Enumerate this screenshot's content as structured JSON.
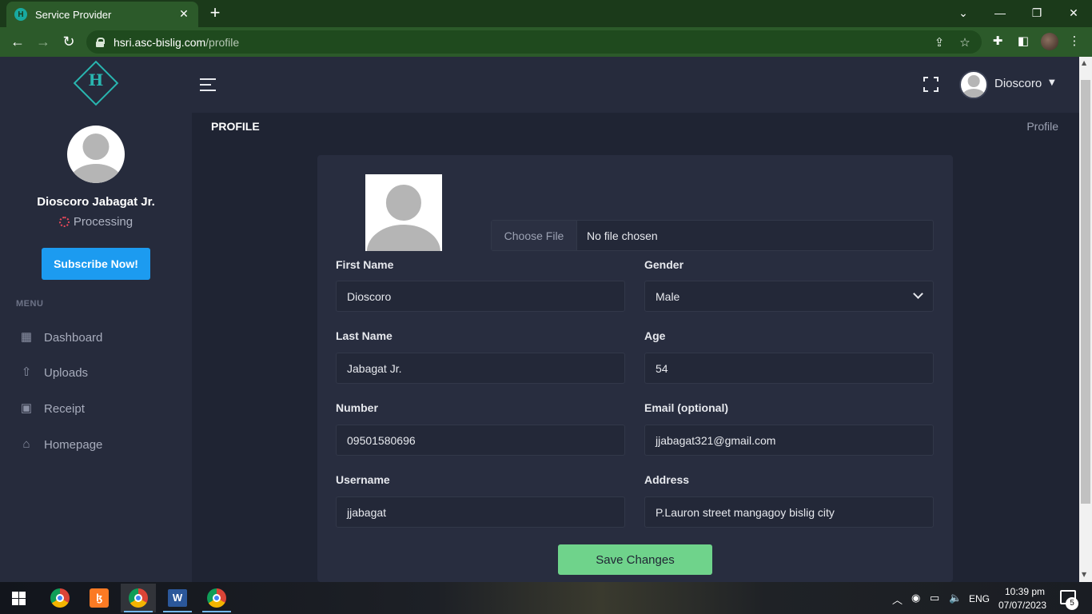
{
  "browser": {
    "tab_title": "Service Provider",
    "tab_favicon_letter": "H",
    "url_host": "hsri.asc-bislig.com",
    "url_path": "/profile"
  },
  "header": {
    "user_name": "Dioscoro"
  },
  "sidebar": {
    "full_name": "Dioscoro Jabagat Jr.",
    "status": "Processing",
    "subscribe_label": "Subscribe Now!",
    "menu_title": "MENU",
    "items": [
      {
        "label": "Dashboard",
        "icon": "dashboard-icon"
      },
      {
        "label": "Uploads",
        "icon": "upload-icon"
      },
      {
        "label": "Receipt",
        "icon": "receipt-icon"
      },
      {
        "label": "Homepage",
        "icon": "home-icon"
      }
    ]
  },
  "page": {
    "title": "PROFILE",
    "breadcrumb": "Profile"
  },
  "form": {
    "file_button": "Choose File",
    "file_status": "No file chosen",
    "first_name_label": "First Name",
    "first_name": "Dioscoro",
    "gender_label": "Gender",
    "gender": "Male",
    "last_name_label": "Last Name",
    "last_name": "Jabagat Jr.",
    "age_label": "Age",
    "age": "54",
    "number_label": "Number",
    "number": "09501580696",
    "email_label": "Email (optional)",
    "email": "jjabagat321@gmail.com",
    "username_label": "Username",
    "username": "jjabagat",
    "address_label": "Address",
    "address": "P.Lauron street mangagoy bislig city",
    "save_label": "Save Changes"
  },
  "taskbar": {
    "language": "ENG",
    "time": "10:39 pm",
    "date": "07/07/2023",
    "notification_count": "5"
  }
}
